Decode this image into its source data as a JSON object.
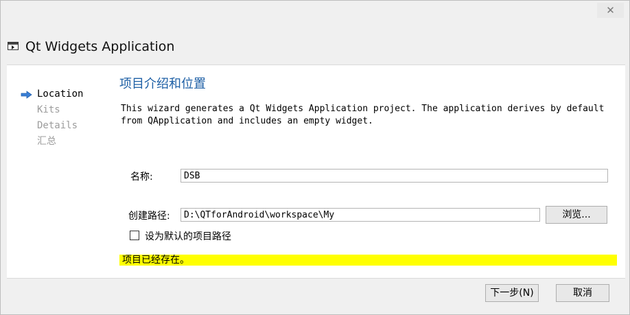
{
  "window": {
    "close_label": "✕",
    "title": "Qt Widgets Application"
  },
  "steps": [
    {
      "label": "Location",
      "active": true
    },
    {
      "label": "Kits",
      "active": false
    },
    {
      "label": "Details",
      "active": false
    },
    {
      "label": "汇总",
      "active": false
    }
  ],
  "page": {
    "title": "项目介绍和位置",
    "description": "This wizard generates a Qt Widgets Application project. The application derives by default\nfrom QApplication and includes an empty widget."
  },
  "form": {
    "name_label": "名称:",
    "name_value": "DSB",
    "path_label": "创建路径:",
    "path_value": "D:\\QTforAndroid\\workspace\\My",
    "browse_label": "浏览...",
    "default_path_label": "设为默认的项目路径",
    "default_path_checked": false
  },
  "warning": "项目已经存在。",
  "footer": {
    "next_label": "下一步(N)",
    "cancel_label": "取消"
  },
  "colors": {
    "accent_title": "#1d5fa5",
    "arrow": "#3a7fd5",
    "warning_bg": "#ffff00",
    "inactive_step": "#9c9c9c"
  }
}
